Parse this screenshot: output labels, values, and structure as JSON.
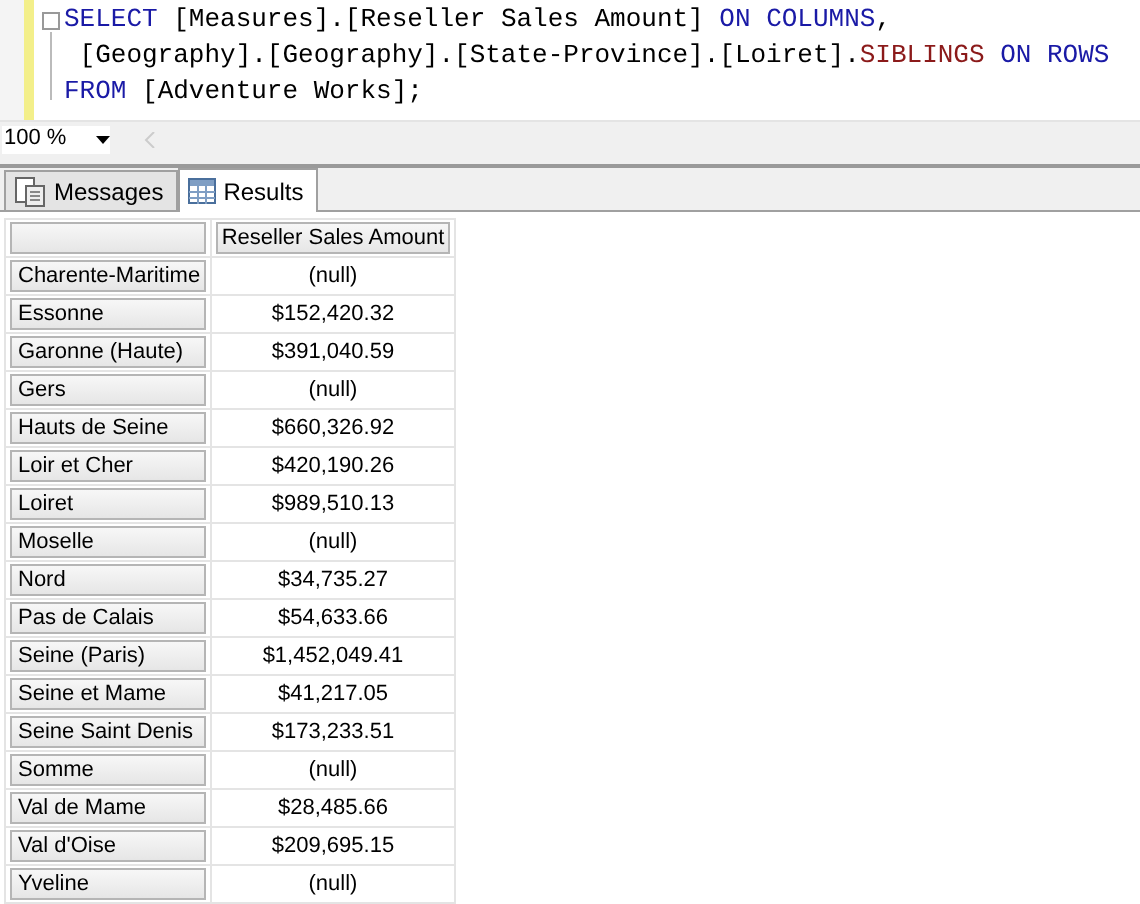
{
  "editor": {
    "lines": [
      [
        {
          "text": "SELECT",
          "kind": "keyword"
        },
        {
          "text": " [Measures].[Reseller Sales Amount] ",
          "kind": "plain"
        },
        {
          "text": "ON COLUMNS",
          "kind": "keyword"
        },
        {
          "text": ",",
          "kind": "plain"
        }
      ],
      [
        {
          "text": " [Geography].[Geography].[State-Province].[Loiret].",
          "kind": "plain"
        },
        {
          "text": "SIBLINGS",
          "kind": "function"
        },
        {
          "text": " ON ROWS",
          "kind": "keyword"
        }
      ],
      [
        {
          "text": "FROM",
          "kind": "keyword"
        },
        {
          "text": " [Adventure Works];",
          "kind": "plain"
        }
      ]
    ]
  },
  "zoom": "100 %",
  "tabs": [
    {
      "label": "Messages",
      "selected": false
    },
    {
      "label": "Results",
      "selected": true
    }
  ],
  "grid": {
    "columns": [
      "Reseller Sales Amount"
    ],
    "rows": [
      {
        "header": "Charente-Maritime",
        "value": "(null)"
      },
      {
        "header": "Essonne",
        "value": "$152,420.32"
      },
      {
        "header": "Garonne (Haute)",
        "value": "$391,040.59"
      },
      {
        "header": "Gers",
        "value": "(null)"
      },
      {
        "header": "Hauts de Seine",
        "value": "$660,326.92"
      },
      {
        "header": "Loir et Cher",
        "value": "$420,190.26"
      },
      {
        "header": "Loiret",
        "value": "$989,510.13"
      },
      {
        "header": "Moselle",
        "value": "(null)"
      },
      {
        "header": "Nord",
        "value": "$34,735.27"
      },
      {
        "header": "Pas de Calais",
        "value": "$54,633.66"
      },
      {
        "header": "Seine (Paris)",
        "value": "$1,452,049.41"
      },
      {
        "header": "Seine et Mame",
        "value": "$41,217.05"
      },
      {
        "header": "Seine Saint Denis",
        "value": "$173,233.51"
      },
      {
        "header": "Somme",
        "value": "(null)"
      },
      {
        "header": "Val de Mame",
        "value": "$28,485.66"
      },
      {
        "header": "Val d'Oise",
        "value": "$209,695.15"
      },
      {
        "header": "Yveline",
        "value": "(null)"
      }
    ]
  }
}
